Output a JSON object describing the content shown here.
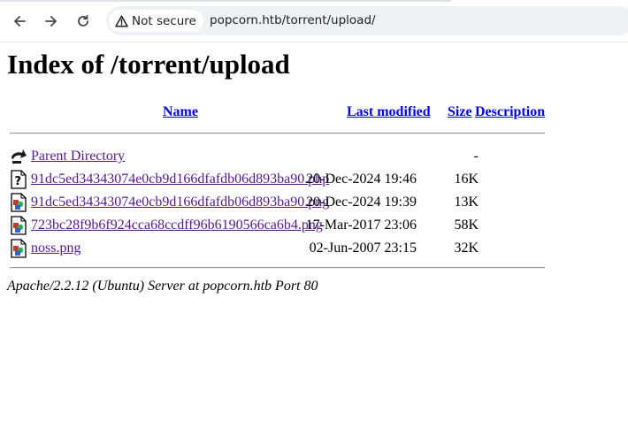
{
  "browser": {
    "security_label": "Not secure",
    "url": "popcorn.htb/torrent/upload/"
  },
  "page": {
    "heading": "Index of /torrent/upload",
    "columns": {
      "name": "Name",
      "last_modified": "Last modified",
      "size": "Size",
      "description": "Description"
    },
    "parent": {
      "label": "Parent Directory",
      "size": "-"
    },
    "entries": [
      {
        "name": "91dc5ed34343074e0cb9d166dfafdb06d893ba90.php",
        "modified": "20-Dec-2024 19:46",
        "size": "16K",
        "icon": "unknown-file-icon"
      },
      {
        "name": "91dc5ed34343074e0cb9d166dfafdb06d893ba90.png",
        "modified": "20-Dec-2024 19:39",
        "size": "13K",
        "icon": "image-file-icon"
      },
      {
        "name": "723bc28f9b6f924cca68ccdff96b6190566ca6b4.png",
        "modified": "17-Mar-2017 23:06",
        "size": "58K",
        "icon": "image-file-icon"
      },
      {
        "name": "noss.png",
        "modified": "02-Jun-2007 23:15",
        "size": "32K",
        "icon": "image-file-icon"
      }
    ],
    "footer": "Apache/2.2.12 (Ubuntu) Server at popcorn.htb Port 80"
  }
}
